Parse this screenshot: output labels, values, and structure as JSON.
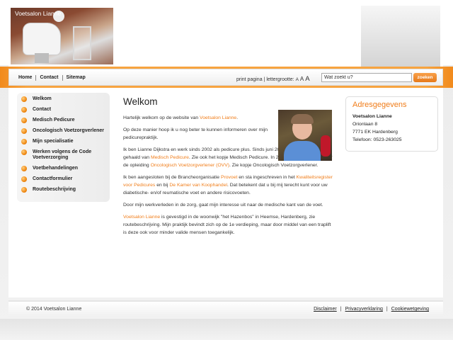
{
  "header": {
    "logo_text": "Voetsalon Lianne"
  },
  "nav": {
    "items": [
      "Home",
      "Contact",
      "Sitemap"
    ]
  },
  "tools": {
    "print": "print pagina",
    "font_label": "lettergrootte:",
    "font_small": "A",
    "font_medium": "A",
    "font_large": "A"
  },
  "search": {
    "value": "Wat zoekt u?",
    "button": "zoeken"
  },
  "sidebar": {
    "items": [
      "Welkom",
      "Contact",
      "Medisch Pedicure",
      "Oncologisch Voetzorgverlener",
      "Mijn specialisatie",
      "Werken volgens de Code Voetverzorging",
      "Voetbehandelingen",
      "Contactformulier",
      "Routebeschrijving"
    ]
  },
  "content": {
    "title": "Welkom",
    "p1_a": "Hartelijk welkom op de website van ",
    "p1_link": "Voetsalon Lianne",
    "p1_b": ".",
    "p2": "Op deze manier hoop ik u nog beter te kunnen informeren over mijn pedicurepraktijk.",
    "p3_a": "Ik ben Lianne Dijkstra en werk sinds 2002 als pedicure plus. Sinds juni 2013 heb ik het diploma gehaald van ",
    "p3_link1": "Medisch Pedicure",
    "p3_b": ". Zie ook het kopje Medisch Pedicure. In 2014 ben ik geslaagd voor de opleiding ",
    "p3_link2": "Oncologisch Voetzorgverlener (OVV)",
    "p3_c": ". Zie kopje Oncologisch Voetzorgverlener.",
    "p4_a": "Ik ben aangesloten bij de Brancheorganisatie ",
    "p4_link1": "Provoet",
    "p4_b": " en sta ingeschreven in het ",
    "p4_link2": "Kwaliteitsregister voor Pedicures",
    "p4_c": " en bij ",
    "p4_link3": "De Kamer van Koophandel",
    "p4_d": ". Dat betekent dat u bij mij terecht kunt voor uw diabetische- en/of reumatische voet en andere risicovoeten.",
    "p5": "Door mijn werkverleden in de zorg, gaat mijn interesse uit naar de medische kant van de voet.",
    "p6_link": "Voetsalon Lianne",
    "p6_a": " is gevestigd in de woonwijk \"het Hazenbos\" in Heemse, Hardenberg, zie routebeschrijving. Mijn praktijk bevindt zich op de 1e verdieping, maar door middel van een traplift is deze ook voor minder valide mensen toegankelijk."
  },
  "address": {
    "title": "Adresgegevens",
    "name": "Voetsalon Lianne",
    "street": "Orionlaan 8",
    "city": "7771 EK Hardenberg",
    "phone": "Telefoon: 0523-263025"
  },
  "footer": {
    "copyright": "© 2014 Voetsalon Lianne",
    "links": [
      "Disclaimer",
      "Privacyverklaring",
      "Cookiewetgeving"
    ],
    "separator": "|"
  },
  "colors": {
    "accent": "#f07d1a",
    "band": "#f7a440"
  }
}
